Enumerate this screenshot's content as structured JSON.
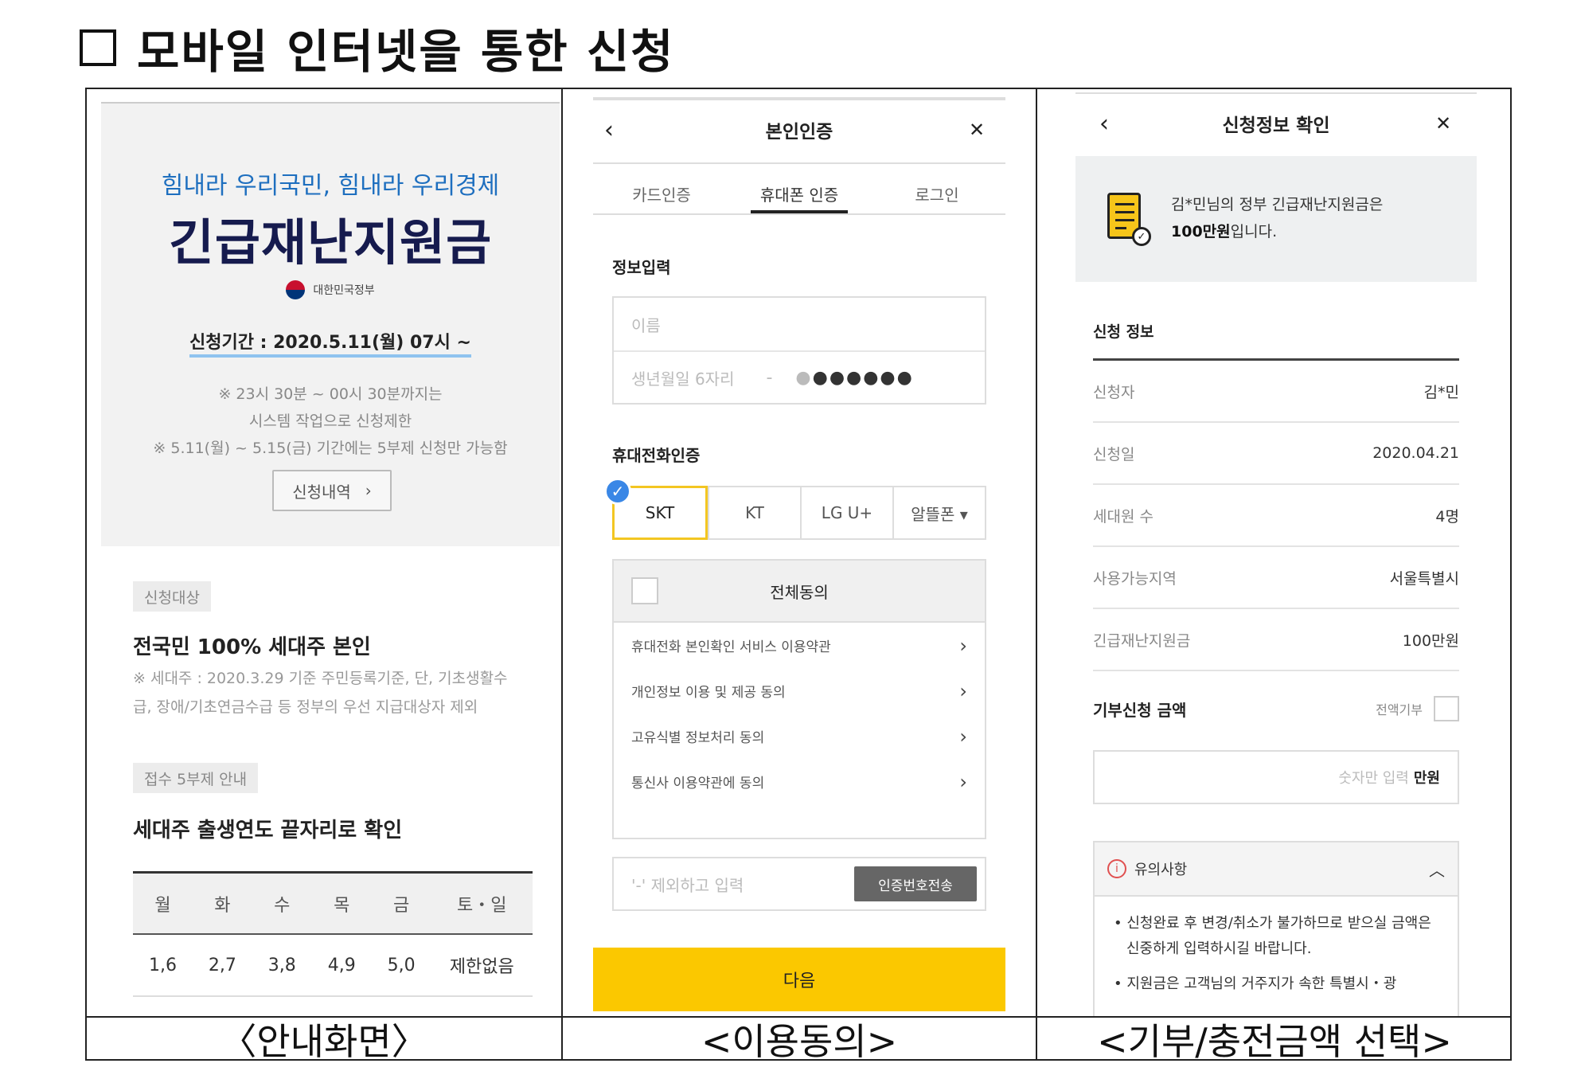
{
  "doc": {
    "title": "모바일 인터넷을 통한 신청",
    "captions": [
      "〈안내화면〉",
      "<이용동의>",
      "<기부/충전금액 선택>"
    ]
  },
  "panel1": {
    "slogan": "힘내라 우리국민, 힘내라 우리경제",
    "big_title": "긴급재난지원금",
    "gov_label": "대한민국정부",
    "period": "신청기간 : 2020.5.11(월) 07시 ~",
    "notes": [
      "※ 23시 30분 ~ 00시 30분까지는",
      "시스템 작업으로 신청제한",
      "※ 5.11(월) ~ 5.15(금) 기간에는 5부제 신청만 가능함"
    ],
    "history_button": "신청내역",
    "target_tag": "신청대상",
    "target_heading": "전국민 100% 세대주 본인",
    "target_note": [
      "※ 세대주 : 2020.3.29 기준 주민등록기준, 단, 기초생활수",
      "급, 장애/기초연금수급 등 정부의 우선 지급대상자 제외"
    ],
    "rotation_tag": "접수 5부제 안내",
    "rotation_heading": "세대주 출생연도 끝자리로 확인",
    "week_headers": [
      "월",
      "화",
      "수",
      "목",
      "금",
      "토・일"
    ],
    "week_values": [
      "1,6",
      "2,7",
      "3,8",
      "4,9",
      "5,0",
      "제한없음"
    ]
  },
  "panel2": {
    "title": "본인인증",
    "back_icon": "‹",
    "close_icon": "✕",
    "tabs": [
      "카드인증",
      "휴대폰 인증",
      "로그인"
    ],
    "active_tab": "휴대폰 인증",
    "info_label": "정보입력",
    "name_placeholder": "이름",
    "birth_placeholder": "생년월일 6자리",
    "masked_dash": "-",
    "masked_first": "●",
    "masked_rest": "●●●●●●",
    "phone_label": "휴대전화인증",
    "carriers": [
      "SKT",
      "KT",
      "LG U+",
      "알뜰폰 ▾"
    ],
    "agree_all": "전체동의",
    "agree_items": [
      "휴대전화 본인확인 서비스 이용약관",
      "개인정보 이용 및 제공 동의",
      "고유식별 정보처리 동의",
      "통신사 이용약관에 동의"
    ],
    "code_placeholder": "'-' 제외하고 입력",
    "code_button": "인증번호전송",
    "next_button": "다음"
  },
  "panel3": {
    "title": "신청정보 확인",
    "back_icon": "‹",
    "close_icon": "✕",
    "banner_line1": "김*민님의 정부 긴급재난지원금은",
    "banner_amount": "100만원",
    "banner_suffix": "입니다.",
    "info_title": "신청 정보",
    "rows": [
      {
        "k": "신청자",
        "v": "김*민"
      },
      {
        "k": "신청일",
        "v": "2020.04.21"
      },
      {
        "k": "세대원 수",
        "v": "4명"
      },
      {
        "k": "사용가능지역",
        "v": "서울특별시"
      },
      {
        "k": "긴급재난지원금",
        "v": "100만원"
      }
    ],
    "donate_title": "기부신청 금액",
    "donate_all": "전액기부",
    "amount_placeholder": "숫자만 입력",
    "amount_unit": "만원",
    "notice_title": "유의사항",
    "notice_items": [
      "• 신청완료 후 변경/취소가 불가하므로 받으실 금액은 신중하게 입력하시길 바랍니다.",
      "• 지원금은 고객님의 거주지가 속한 특별시・광"
    ]
  }
}
